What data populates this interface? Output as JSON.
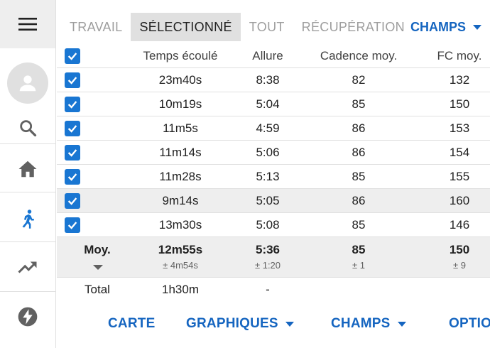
{
  "tabs": [
    "TRAVAIL",
    "SÉLECTIONNÉ",
    "TOUT",
    "RÉCUPÉRATION"
  ],
  "active_tab_index": 1,
  "fields_button": "CHAMPS",
  "columns": [
    "Temps écoulé",
    "Allure",
    "Cadence moy.",
    "FC moy."
  ],
  "rows": [
    {
      "checked": true,
      "time": "23m40s",
      "pace": "8:38",
      "cadence": "82",
      "hr": "132"
    },
    {
      "checked": true,
      "time": "10m19s",
      "pace": "5:04",
      "cadence": "85",
      "hr": "150"
    },
    {
      "checked": true,
      "time": "11m5s",
      "pace": "4:59",
      "cadence": "86",
      "hr": "153"
    },
    {
      "checked": true,
      "time": "11m14s",
      "pace": "5:06",
      "cadence": "86",
      "hr": "154"
    },
    {
      "checked": true,
      "time": "11m28s",
      "pace": "5:13",
      "cadence": "85",
      "hr": "155"
    },
    {
      "checked": true,
      "time": "9m14s",
      "pace": "5:05",
      "cadence": "86",
      "hr": "160",
      "highlighted": true
    },
    {
      "checked": true,
      "time": "13m30s",
      "pace": "5:08",
      "cadence": "85",
      "hr": "146"
    }
  ],
  "average": {
    "label": "Moy.",
    "time": "12m55s",
    "time_sd": "± 4m54s",
    "pace": "5:36",
    "pace_sd": "± 1:20",
    "cadence": "85",
    "cadence_sd": "± 1",
    "hr": "150",
    "hr_sd": "± 9"
  },
  "total": {
    "label": "Total",
    "time": "1h30m",
    "pace": "-"
  },
  "bottom_buttons": [
    "CARTE",
    "GRAPHIQUES",
    "CHAMPS",
    "OPTIO"
  ],
  "colors": {
    "accent": "#1976d2",
    "text": "#212121",
    "muted": "#9e9e9e",
    "shade": "#eeeeee"
  }
}
